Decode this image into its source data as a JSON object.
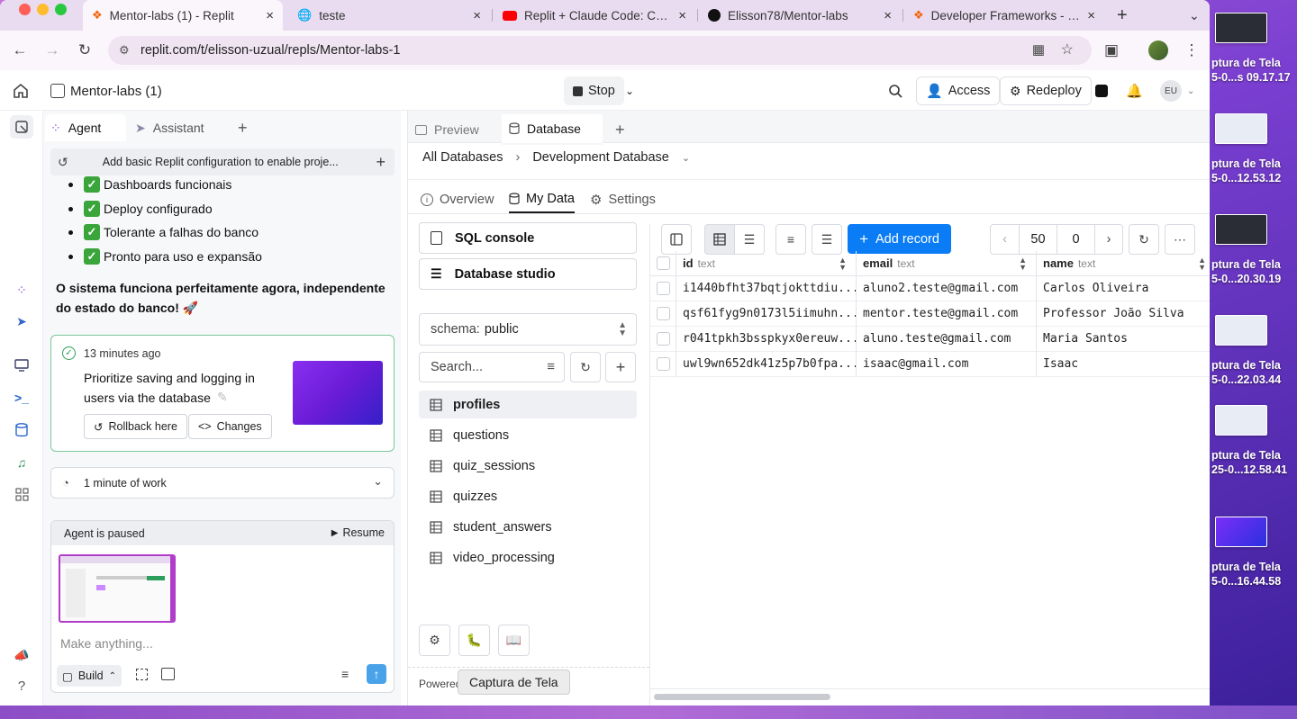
{
  "browser": {
    "tabs": [
      {
        "title": "Mentor-labs (1) - Replit",
        "icon": "replit-icon",
        "active": true
      },
      {
        "title": "teste",
        "icon": "globe-icon",
        "active": false
      },
      {
        "title": "Replit + Claude Code: Comp",
        "icon": "youtube-icon",
        "active": false
      },
      {
        "title": "Elisson78/Mentor-labs",
        "icon": "github-icon",
        "active": false
      },
      {
        "title": "Developer Frameworks - Re",
        "icon": "replit-icon",
        "active": false
      }
    ],
    "url": "replit.com/t/elisson-uzual/repls/Mentor-labs-1"
  },
  "header": {
    "project_name": "Mentor-labs (1)",
    "stop_label": "Stop",
    "access_label": "Access",
    "redeploy_label": "Redeploy",
    "avatar_initials": "EU"
  },
  "agent": {
    "tabs": {
      "agent": "Agent",
      "assistant": "Assistant"
    },
    "history_title": "Add basic Replit configuration to enable proje...",
    "bullets": [
      "Dashboards funcionais",
      "Deploy configurado",
      "Tolerante a falhas do banco",
      "Pronto para uso e expansão"
    ],
    "summary": "O sistema funciona perfeitamente agora, independente do estado do banco! 🚀",
    "checkpoint": {
      "time": "13 minutes ago",
      "text": "Prioritize saving and logging in users via the database",
      "rollback_label": "Rollback here",
      "changes_label": "Changes"
    },
    "work_label": "1 minute of work",
    "paused_label": "Agent is paused",
    "resume_label": "Resume",
    "input_placeholder": "Make anything...",
    "build_label": "Build"
  },
  "db": {
    "tabs": {
      "preview": "Preview",
      "database": "Database"
    },
    "breadcrumb": {
      "root": "All Databases",
      "current": "Development Database"
    },
    "subtabs": {
      "overview": "Overview",
      "mydata": "My Data",
      "settings": "Settings"
    },
    "sql_console": "SQL console",
    "db_studio": "Database studio",
    "schema_label": "schema:",
    "schema_value": "public",
    "search_placeholder": "Search...",
    "tables": [
      "profiles",
      "questions",
      "quiz_sessions",
      "quizzes",
      "student_answers",
      "video_processing"
    ],
    "selected_table": "profiles",
    "add_record": "Add record",
    "page_size": "50",
    "offset": "0",
    "powered_by": "Powered",
    "tooltip": "Captura de Tela",
    "columns": [
      {
        "name": "id",
        "type": "text"
      },
      {
        "name": "email",
        "type": "text"
      },
      {
        "name": "name",
        "type": "text"
      }
    ],
    "rows": [
      [
        "i1440bfht37bqtjokttdiu...",
        "aluno2.teste@gmail.com",
        "Carlos Oliveira"
      ],
      [
        "qsf61fyg9n0173l5iimuhn...",
        "mentor.teste@gmail.com",
        "Professor João Silva"
      ],
      [
        "r041tpkh3bsspkyx0ereuw...",
        "aluno.teste@gmail.com",
        "Maria Santos"
      ],
      [
        "uwl9wn652dk41z5p7b0fpa...",
        "isaac@gmail.com",
        "Isaac"
      ]
    ]
  },
  "desktop": {
    "files": [
      {
        "line1": "ptura de Tela",
        "line2": "5-0...s 09.17.17",
        "thumb": "dark"
      },
      {
        "line1": "ptura de Tela",
        "line2": "5-0...12.53.12",
        "thumb": "light"
      },
      {
        "line1": "ptura de Tela",
        "line2": "5-0...20.30.19",
        "thumb": "dark"
      },
      {
        "line1": "ptura de Tela",
        "line2": "5-0...22.03.44",
        "thumb": "light"
      },
      {
        "line1": "ptura de Tela",
        "line2": "25-0...12.58.41",
        "thumb": "light"
      },
      {
        "line1": "ptura de Tela",
        "line2": "5-0...16.44.58",
        "thumb": "purple"
      }
    ]
  }
}
